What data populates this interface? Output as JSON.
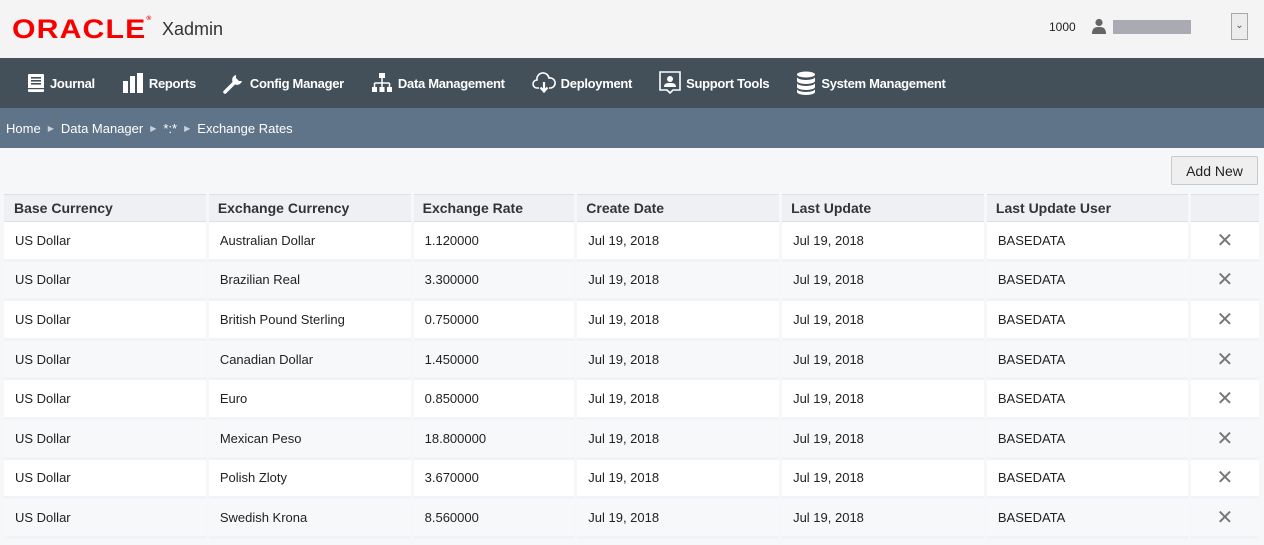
{
  "header": {
    "brand": "ORACLE",
    "app_name": "Xadmin",
    "org_id": "1000",
    "user_icon": "user-icon",
    "user_dropdown_icon": "chevron-down-icon"
  },
  "nav": [
    {
      "label": "Journal",
      "icon": "book-icon"
    },
    {
      "label": "Reports",
      "icon": "bar-chart-icon"
    },
    {
      "label": "Config Manager",
      "icon": "wrench-icon"
    },
    {
      "label": "Data Management",
      "icon": "hierarchy-icon"
    },
    {
      "label": "Deployment",
      "icon": "cloud-download-icon"
    },
    {
      "label": "Support Tools",
      "icon": "support-person-icon"
    },
    {
      "label": "System Management",
      "icon": "database-icon"
    }
  ],
  "breadcrumb": [
    "Home",
    "Data Manager",
    "*:*",
    "Exchange Rates"
  ],
  "toolbar": {
    "add_new_label": "Add New"
  },
  "table": {
    "columns": [
      "Base Currency",
      "Exchange Currency",
      "Exchange Rate",
      "Create Date",
      "Last Update",
      "Last Update User",
      ""
    ],
    "rows": [
      {
        "base": "US Dollar",
        "exchange": "Australian Dollar",
        "rate": "1.120000",
        "created": "Jul 19, 2018",
        "updated": "Jul 19, 2018",
        "user": "BASEDATA",
        "delete": "✕"
      },
      {
        "base": "US Dollar",
        "exchange": "Brazilian Real",
        "rate": "3.300000",
        "created": "Jul 19, 2018",
        "updated": "Jul 19, 2018",
        "user": "BASEDATA",
        "delete": "✕"
      },
      {
        "base": "US Dollar",
        "exchange": "British Pound Sterling",
        "rate": "0.750000",
        "created": "Jul 19, 2018",
        "updated": "Jul 19, 2018",
        "user": "BASEDATA",
        "delete": "✕"
      },
      {
        "base": "US Dollar",
        "exchange": "Canadian Dollar",
        "rate": "1.450000",
        "created": "Jul 19, 2018",
        "updated": "Jul 19, 2018",
        "user": "BASEDATA",
        "delete": "✕"
      },
      {
        "base": "US Dollar",
        "exchange": "Euro",
        "rate": "0.850000",
        "created": "Jul 19, 2018",
        "updated": "Jul 19, 2018",
        "user": "BASEDATA",
        "delete": "✕"
      },
      {
        "base": "US Dollar",
        "exchange": "Mexican Peso",
        "rate": "18.800000",
        "created": "Jul 19, 2018",
        "updated": "Jul 19, 2018",
        "user": "BASEDATA",
        "delete": "✕"
      },
      {
        "base": "US Dollar",
        "exchange": "Polish Zloty",
        "rate": "3.670000",
        "created": "Jul 19, 2018",
        "updated": "Jul 19, 2018",
        "user": "BASEDATA",
        "delete": "✕"
      },
      {
        "base": "US Dollar",
        "exchange": "Swedish Krona",
        "rate": "8.560000",
        "created": "Jul 19, 2018",
        "updated": "Jul 19, 2018",
        "user": "BASEDATA",
        "delete": "✕"
      }
    ]
  },
  "colors": {
    "brand_red": "#f80000",
    "nav_bg": "#434f59",
    "breadcrumb_bg": "#5f7489"
  }
}
